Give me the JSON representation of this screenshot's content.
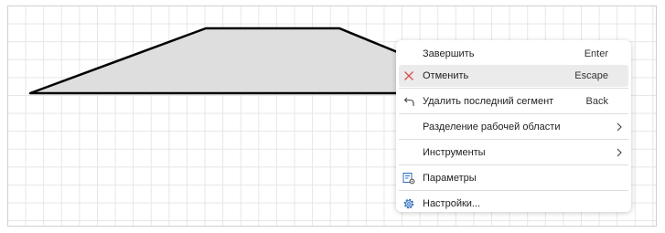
{
  "colors": {
    "grid": "#e6e6e6",
    "shape_fill": "#dedede",
    "shape_stroke": "#000000",
    "cancel_icon": "#d9534f",
    "accent_icon": "#2a6ebb",
    "highlight": "#ebebeb"
  },
  "context_menu": {
    "items": [
      {
        "label": "Завершить",
        "shortcut": "Enter",
        "icon": null,
        "submenu": false
      },
      {
        "label": "Отменить",
        "shortcut": "Escape",
        "icon": "close-icon",
        "submenu": false,
        "highlighted": true
      },
      {
        "label": "Удалить последний сегмент",
        "shortcut": "Back",
        "icon": "undo-arrow-icon",
        "submenu": false
      },
      {
        "label": "Разделение рабочей области",
        "shortcut": "",
        "icon": null,
        "submenu": true
      },
      {
        "label": "Инструменты",
        "shortcut": "",
        "icon": null,
        "submenu": true
      },
      {
        "label": "Параметры",
        "shortcut": "",
        "icon": "parameters-icon",
        "submenu": false
      },
      {
        "label": "Настройки...",
        "shortcut": "",
        "icon": "settings-gear-icon",
        "submenu": false
      }
    ]
  }
}
